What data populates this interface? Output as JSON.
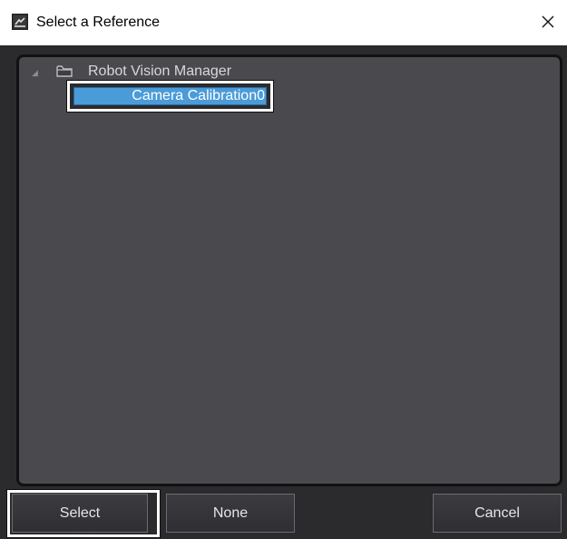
{
  "window": {
    "title": "Select a Reference",
    "icon": "app-icon",
    "close_glyph": "✕"
  },
  "tree": {
    "root": {
      "label": "Robot Vision Manager",
      "expander_glyph": "◢",
      "icon": "folder-icon"
    },
    "children": [
      {
        "label": "Camera Calibration0",
        "selected": true
      }
    ]
  },
  "buttons": {
    "select_label": "Select",
    "none_label": "None",
    "cancel_label": "Cancel"
  },
  "colors": {
    "body_bg": "#2b2b2e",
    "panel_bg": "#4a4a4e",
    "selection": "#4a9bd8",
    "highlight_frame": "#ffffff"
  }
}
